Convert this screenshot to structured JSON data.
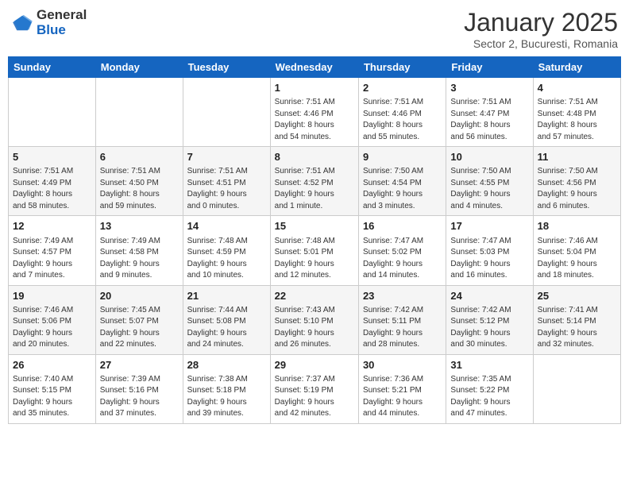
{
  "logo": {
    "text_general": "General",
    "text_blue": "Blue"
  },
  "title": "January 2025",
  "subtitle": "Sector 2, Bucuresti, Romania",
  "header_days": [
    "Sunday",
    "Monday",
    "Tuesday",
    "Wednesday",
    "Thursday",
    "Friday",
    "Saturday"
  ],
  "weeks": [
    [
      {
        "day": "",
        "info": ""
      },
      {
        "day": "",
        "info": ""
      },
      {
        "day": "",
        "info": ""
      },
      {
        "day": "1",
        "info": "Sunrise: 7:51 AM\nSunset: 4:46 PM\nDaylight: 8 hours\nand 54 minutes."
      },
      {
        "day": "2",
        "info": "Sunrise: 7:51 AM\nSunset: 4:46 PM\nDaylight: 8 hours\nand 55 minutes."
      },
      {
        "day": "3",
        "info": "Sunrise: 7:51 AM\nSunset: 4:47 PM\nDaylight: 8 hours\nand 56 minutes."
      },
      {
        "day": "4",
        "info": "Sunrise: 7:51 AM\nSunset: 4:48 PM\nDaylight: 8 hours\nand 57 minutes."
      }
    ],
    [
      {
        "day": "5",
        "info": "Sunrise: 7:51 AM\nSunset: 4:49 PM\nDaylight: 8 hours\nand 58 minutes."
      },
      {
        "day": "6",
        "info": "Sunrise: 7:51 AM\nSunset: 4:50 PM\nDaylight: 8 hours\nand 59 minutes."
      },
      {
        "day": "7",
        "info": "Sunrise: 7:51 AM\nSunset: 4:51 PM\nDaylight: 9 hours\nand 0 minutes."
      },
      {
        "day": "8",
        "info": "Sunrise: 7:51 AM\nSunset: 4:52 PM\nDaylight: 9 hours\nand 1 minute."
      },
      {
        "day": "9",
        "info": "Sunrise: 7:50 AM\nSunset: 4:54 PM\nDaylight: 9 hours\nand 3 minutes."
      },
      {
        "day": "10",
        "info": "Sunrise: 7:50 AM\nSunset: 4:55 PM\nDaylight: 9 hours\nand 4 minutes."
      },
      {
        "day": "11",
        "info": "Sunrise: 7:50 AM\nSunset: 4:56 PM\nDaylight: 9 hours\nand 6 minutes."
      }
    ],
    [
      {
        "day": "12",
        "info": "Sunrise: 7:49 AM\nSunset: 4:57 PM\nDaylight: 9 hours\nand 7 minutes."
      },
      {
        "day": "13",
        "info": "Sunrise: 7:49 AM\nSunset: 4:58 PM\nDaylight: 9 hours\nand 9 minutes."
      },
      {
        "day": "14",
        "info": "Sunrise: 7:48 AM\nSunset: 4:59 PM\nDaylight: 9 hours\nand 10 minutes."
      },
      {
        "day": "15",
        "info": "Sunrise: 7:48 AM\nSunset: 5:01 PM\nDaylight: 9 hours\nand 12 minutes."
      },
      {
        "day": "16",
        "info": "Sunrise: 7:47 AM\nSunset: 5:02 PM\nDaylight: 9 hours\nand 14 minutes."
      },
      {
        "day": "17",
        "info": "Sunrise: 7:47 AM\nSunset: 5:03 PM\nDaylight: 9 hours\nand 16 minutes."
      },
      {
        "day": "18",
        "info": "Sunrise: 7:46 AM\nSunset: 5:04 PM\nDaylight: 9 hours\nand 18 minutes."
      }
    ],
    [
      {
        "day": "19",
        "info": "Sunrise: 7:46 AM\nSunset: 5:06 PM\nDaylight: 9 hours\nand 20 minutes."
      },
      {
        "day": "20",
        "info": "Sunrise: 7:45 AM\nSunset: 5:07 PM\nDaylight: 9 hours\nand 22 minutes."
      },
      {
        "day": "21",
        "info": "Sunrise: 7:44 AM\nSunset: 5:08 PM\nDaylight: 9 hours\nand 24 minutes."
      },
      {
        "day": "22",
        "info": "Sunrise: 7:43 AM\nSunset: 5:10 PM\nDaylight: 9 hours\nand 26 minutes."
      },
      {
        "day": "23",
        "info": "Sunrise: 7:42 AM\nSunset: 5:11 PM\nDaylight: 9 hours\nand 28 minutes."
      },
      {
        "day": "24",
        "info": "Sunrise: 7:42 AM\nSunset: 5:12 PM\nDaylight: 9 hours\nand 30 minutes."
      },
      {
        "day": "25",
        "info": "Sunrise: 7:41 AM\nSunset: 5:14 PM\nDaylight: 9 hours\nand 32 minutes."
      }
    ],
    [
      {
        "day": "26",
        "info": "Sunrise: 7:40 AM\nSunset: 5:15 PM\nDaylight: 9 hours\nand 35 minutes."
      },
      {
        "day": "27",
        "info": "Sunrise: 7:39 AM\nSunset: 5:16 PM\nDaylight: 9 hours\nand 37 minutes."
      },
      {
        "day": "28",
        "info": "Sunrise: 7:38 AM\nSunset: 5:18 PM\nDaylight: 9 hours\nand 39 minutes."
      },
      {
        "day": "29",
        "info": "Sunrise: 7:37 AM\nSunset: 5:19 PM\nDaylight: 9 hours\nand 42 minutes."
      },
      {
        "day": "30",
        "info": "Sunrise: 7:36 AM\nSunset: 5:21 PM\nDaylight: 9 hours\nand 44 minutes."
      },
      {
        "day": "31",
        "info": "Sunrise: 7:35 AM\nSunset: 5:22 PM\nDaylight: 9 hours\nand 47 minutes."
      },
      {
        "day": "",
        "info": ""
      }
    ]
  ]
}
